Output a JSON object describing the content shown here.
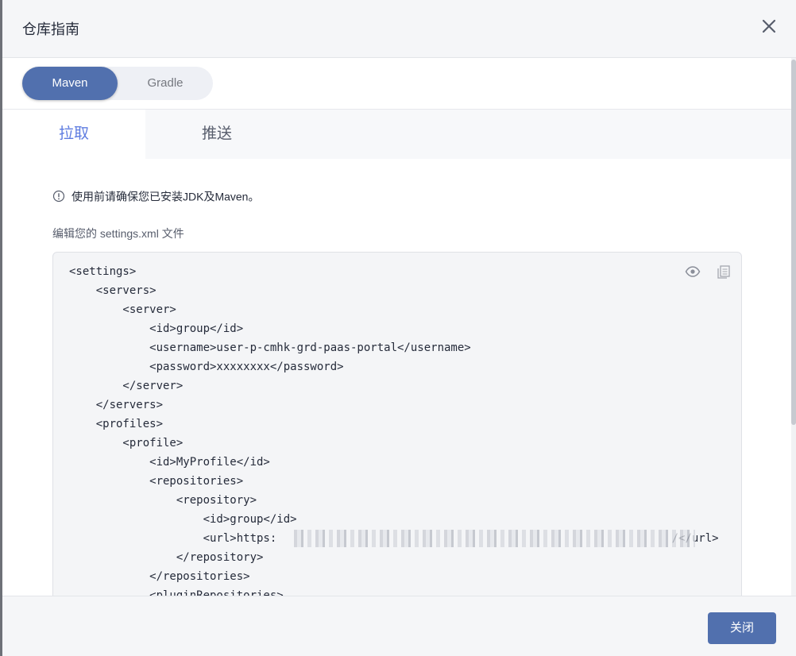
{
  "dialog": {
    "title": "仓库指南",
    "close_icon": "close-icon"
  },
  "build_switch": {
    "options": [
      "Maven",
      "Gradle"
    ],
    "selected": "Maven"
  },
  "tabs": [
    {
      "label": "拉取",
      "active": true
    },
    {
      "label": "推送",
      "active": false
    }
  ],
  "notice": {
    "icon": "info-circle-icon",
    "text": "使用前请确保您已安装JDK及Maven。"
  },
  "code_section": {
    "label": "编辑您的 settings.xml 文件",
    "actions": {
      "view_icon": "eye-icon",
      "copy_icon": "copy-icon"
    },
    "lines": [
      "<settings>",
      "    <servers>",
      "        <server>",
      "            <id>group</id>",
      "            <username>user-p-cmhk-grd-paas-portal</username>",
      "            <password>xxxxxxxx</password>",
      "        </server>",
      "    </servers>",
      "    <profiles>",
      "        <profile>",
      "            <id>MyProfile</id>",
      "            <repositories>",
      "                <repository>",
      "                    <id>group</id>",
      "                    <url>https:                                                           /</url>",
      "                </repository>",
      "            </repositories>",
      "            <pluginRepositories>"
    ]
  },
  "footer": {
    "close_label": "关闭"
  },
  "colors": {
    "primary": "#5170ae",
    "tab_active": "#5e7ce0",
    "header_bg": "#f5f6f8",
    "code_bg": "#f4f5f7"
  }
}
